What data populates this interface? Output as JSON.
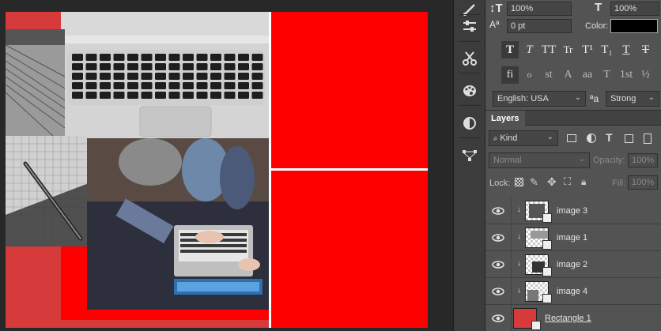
{
  "character": {
    "vertical_scale": "100%",
    "horizontal_scale": "100%",
    "baseline_shift": "0 pt",
    "color_label": "Color:",
    "color_value": "#000000",
    "language": "English: USA",
    "aa_label": "a",
    "antialias": "Strong",
    "style_buttons": [
      "T",
      "T",
      "TT",
      "Tr",
      "T¹",
      "T₁",
      "T",
      "T"
    ],
    "opentype_buttons": [
      "fi",
      "ℴ",
      "st",
      "A",
      "aa",
      "T",
      "1st",
      "½"
    ]
  },
  "layers": {
    "tab_label": "Layers",
    "filter_kind": "Kind",
    "blend_mode": "Normal",
    "opacity_label": "Opacity:",
    "opacity_value": "100%",
    "lock_label": "Lock:",
    "fill_label": "Fill:",
    "fill_value": "100%",
    "rows": [
      {
        "name": "image 3"
      },
      {
        "name": "image 1"
      },
      {
        "name": "image 2"
      },
      {
        "name": "image 4"
      },
      {
        "name": "Rectangle 1"
      }
    ]
  },
  "colors": {
    "canvas_red": "#ff0000",
    "accent_red": "#d63a3a",
    "panel_bg": "#535353"
  },
  "icons": [
    "brush-icon",
    "sliders-icon",
    "scissors-icon",
    "palette-icon",
    "adjustments-icon",
    "path-icon",
    "eye-icon",
    "image-filter-icon",
    "circle-half-icon",
    "type-filter-icon",
    "shape-filter-icon",
    "smartobject-filter-icon",
    "lock-transparent-icon",
    "lock-brush-icon",
    "lock-move-icon",
    "lock-artboard-icon",
    "lock-all-icon"
  ]
}
